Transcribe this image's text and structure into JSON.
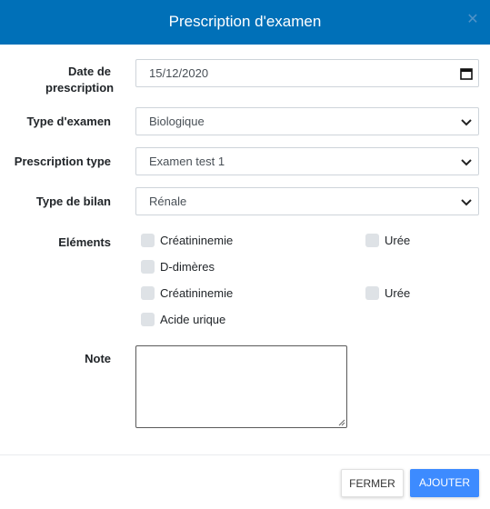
{
  "dialog": {
    "title": "Prescription d'examen",
    "close_icon": "close-icon"
  },
  "form": {
    "date_label_line1": "Date de",
    "date_label_line2": "prescription",
    "date_value": "15/12/2020",
    "type_examen_label": "Type d'examen",
    "type_examen_value": "Biologique",
    "prescription_type_label": "Prescription type",
    "prescription_type_value": "Examen test 1",
    "type_bilan_label": "Type de bilan",
    "type_bilan_value": "Rénale",
    "elements_label": "Eléments",
    "elements": [
      {
        "label": "Créatininemie",
        "checked": false
      },
      {
        "label": "Urée",
        "checked": false
      },
      {
        "label": "D-dimères",
        "checked": false
      },
      {
        "label": "Créatininemie",
        "checked": false
      },
      {
        "label": "Urée",
        "checked": false
      },
      {
        "label": "Acide urique",
        "checked": false
      }
    ],
    "note_label": "Note",
    "note_value": ""
  },
  "footer": {
    "cancel_label": "FERMER",
    "submit_label": "AJOUTER"
  },
  "colors": {
    "header_bg": "#0070b8",
    "primary_button": "#3d8bff",
    "checkbox_bg": "#dee2e6"
  }
}
